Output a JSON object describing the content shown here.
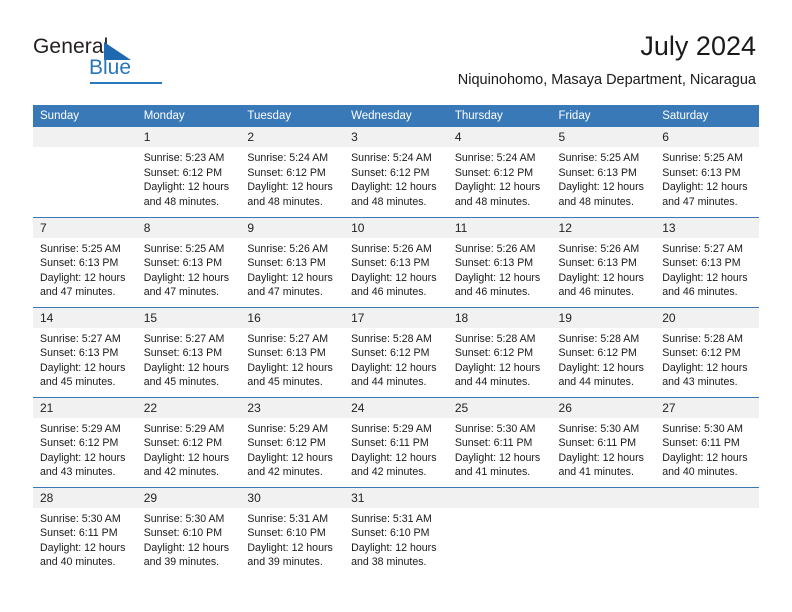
{
  "logo": {
    "primary_text": "General",
    "secondary_text": "Blue",
    "triangle_color": "#1f69b0",
    "blue_color": "#2777bc"
  },
  "header": {
    "title": "July 2024",
    "subtitle": "Niquinohomo, Masaya Department, Nicaragua"
  },
  "theme": {
    "header_blue": "#3a79b8",
    "daynum_gray": "#f1f1f1",
    "text_color": "#1a1a1a"
  },
  "calendar": {
    "weekday_headers": [
      "Sunday",
      "Monday",
      "Tuesday",
      "Wednesday",
      "Thursday",
      "Friday",
      "Saturday"
    ],
    "weeks": [
      [
        {
          "day": "",
          "sunrise": "",
          "sunset": "",
          "daylight_line1": "",
          "daylight_line2": ""
        },
        {
          "day": "1",
          "sunrise": "Sunrise: 5:23 AM",
          "sunset": "Sunset: 6:12 PM",
          "daylight_line1": "Daylight: 12 hours",
          "daylight_line2": "and 48 minutes."
        },
        {
          "day": "2",
          "sunrise": "Sunrise: 5:24 AM",
          "sunset": "Sunset: 6:12 PM",
          "daylight_line1": "Daylight: 12 hours",
          "daylight_line2": "and 48 minutes."
        },
        {
          "day": "3",
          "sunrise": "Sunrise: 5:24 AM",
          "sunset": "Sunset: 6:12 PM",
          "daylight_line1": "Daylight: 12 hours",
          "daylight_line2": "and 48 minutes."
        },
        {
          "day": "4",
          "sunrise": "Sunrise: 5:24 AM",
          "sunset": "Sunset: 6:12 PM",
          "daylight_line1": "Daylight: 12 hours",
          "daylight_line2": "and 48 minutes."
        },
        {
          "day": "5",
          "sunrise": "Sunrise: 5:25 AM",
          "sunset": "Sunset: 6:13 PM",
          "daylight_line1": "Daylight: 12 hours",
          "daylight_line2": "and 48 minutes."
        },
        {
          "day": "6",
          "sunrise": "Sunrise: 5:25 AM",
          "sunset": "Sunset: 6:13 PM",
          "daylight_line1": "Daylight: 12 hours",
          "daylight_line2": "and 47 minutes."
        }
      ],
      [
        {
          "day": "7",
          "sunrise": "Sunrise: 5:25 AM",
          "sunset": "Sunset: 6:13 PM",
          "daylight_line1": "Daylight: 12 hours",
          "daylight_line2": "and 47 minutes."
        },
        {
          "day": "8",
          "sunrise": "Sunrise: 5:25 AM",
          "sunset": "Sunset: 6:13 PM",
          "daylight_line1": "Daylight: 12 hours",
          "daylight_line2": "and 47 minutes."
        },
        {
          "day": "9",
          "sunrise": "Sunrise: 5:26 AM",
          "sunset": "Sunset: 6:13 PM",
          "daylight_line1": "Daylight: 12 hours",
          "daylight_line2": "and 47 minutes."
        },
        {
          "day": "10",
          "sunrise": "Sunrise: 5:26 AM",
          "sunset": "Sunset: 6:13 PM",
          "daylight_line1": "Daylight: 12 hours",
          "daylight_line2": "and 46 minutes."
        },
        {
          "day": "11",
          "sunrise": "Sunrise: 5:26 AM",
          "sunset": "Sunset: 6:13 PM",
          "daylight_line1": "Daylight: 12 hours",
          "daylight_line2": "and 46 minutes."
        },
        {
          "day": "12",
          "sunrise": "Sunrise: 5:26 AM",
          "sunset": "Sunset: 6:13 PM",
          "daylight_line1": "Daylight: 12 hours",
          "daylight_line2": "and 46 minutes."
        },
        {
          "day": "13",
          "sunrise": "Sunrise: 5:27 AM",
          "sunset": "Sunset: 6:13 PM",
          "daylight_line1": "Daylight: 12 hours",
          "daylight_line2": "and 46 minutes."
        }
      ],
      [
        {
          "day": "14",
          "sunrise": "Sunrise: 5:27 AM",
          "sunset": "Sunset: 6:13 PM",
          "daylight_line1": "Daylight: 12 hours",
          "daylight_line2": "and 45 minutes."
        },
        {
          "day": "15",
          "sunrise": "Sunrise: 5:27 AM",
          "sunset": "Sunset: 6:13 PM",
          "daylight_line1": "Daylight: 12 hours",
          "daylight_line2": "and 45 minutes."
        },
        {
          "day": "16",
          "sunrise": "Sunrise: 5:27 AM",
          "sunset": "Sunset: 6:13 PM",
          "daylight_line1": "Daylight: 12 hours",
          "daylight_line2": "and 45 minutes."
        },
        {
          "day": "17",
          "sunrise": "Sunrise: 5:28 AM",
          "sunset": "Sunset: 6:12 PM",
          "daylight_line1": "Daylight: 12 hours",
          "daylight_line2": "and 44 minutes."
        },
        {
          "day": "18",
          "sunrise": "Sunrise: 5:28 AM",
          "sunset": "Sunset: 6:12 PM",
          "daylight_line1": "Daylight: 12 hours",
          "daylight_line2": "and 44 minutes."
        },
        {
          "day": "19",
          "sunrise": "Sunrise: 5:28 AM",
          "sunset": "Sunset: 6:12 PM",
          "daylight_line1": "Daylight: 12 hours",
          "daylight_line2": "and 44 minutes."
        },
        {
          "day": "20",
          "sunrise": "Sunrise: 5:28 AM",
          "sunset": "Sunset: 6:12 PM",
          "daylight_line1": "Daylight: 12 hours",
          "daylight_line2": "and 43 minutes."
        }
      ],
      [
        {
          "day": "21",
          "sunrise": "Sunrise: 5:29 AM",
          "sunset": "Sunset: 6:12 PM",
          "daylight_line1": "Daylight: 12 hours",
          "daylight_line2": "and 43 minutes."
        },
        {
          "day": "22",
          "sunrise": "Sunrise: 5:29 AM",
          "sunset": "Sunset: 6:12 PM",
          "daylight_line1": "Daylight: 12 hours",
          "daylight_line2": "and 42 minutes."
        },
        {
          "day": "23",
          "sunrise": "Sunrise: 5:29 AM",
          "sunset": "Sunset: 6:12 PM",
          "daylight_line1": "Daylight: 12 hours",
          "daylight_line2": "and 42 minutes."
        },
        {
          "day": "24",
          "sunrise": "Sunrise: 5:29 AM",
          "sunset": "Sunset: 6:11 PM",
          "daylight_line1": "Daylight: 12 hours",
          "daylight_line2": "and 42 minutes."
        },
        {
          "day": "25",
          "sunrise": "Sunrise: 5:30 AM",
          "sunset": "Sunset: 6:11 PM",
          "daylight_line1": "Daylight: 12 hours",
          "daylight_line2": "and 41 minutes."
        },
        {
          "day": "26",
          "sunrise": "Sunrise: 5:30 AM",
          "sunset": "Sunset: 6:11 PM",
          "daylight_line1": "Daylight: 12 hours",
          "daylight_line2": "and 41 minutes."
        },
        {
          "day": "27",
          "sunrise": "Sunrise: 5:30 AM",
          "sunset": "Sunset: 6:11 PM",
          "daylight_line1": "Daylight: 12 hours",
          "daylight_line2": "and 40 minutes."
        }
      ],
      [
        {
          "day": "28",
          "sunrise": "Sunrise: 5:30 AM",
          "sunset": "Sunset: 6:11 PM",
          "daylight_line1": "Daylight: 12 hours",
          "daylight_line2": "and 40 minutes."
        },
        {
          "day": "29",
          "sunrise": "Sunrise: 5:30 AM",
          "sunset": "Sunset: 6:10 PM",
          "daylight_line1": "Daylight: 12 hours",
          "daylight_line2": "and 39 minutes."
        },
        {
          "day": "30",
          "sunrise": "Sunrise: 5:31 AM",
          "sunset": "Sunset: 6:10 PM",
          "daylight_line1": "Daylight: 12 hours",
          "daylight_line2": "and 39 minutes."
        },
        {
          "day": "31",
          "sunrise": "Sunrise: 5:31 AM",
          "sunset": "Sunset: 6:10 PM",
          "daylight_line1": "Daylight: 12 hours",
          "daylight_line2": "and 38 minutes."
        },
        {
          "day": "",
          "sunrise": "",
          "sunset": "",
          "daylight_line1": "",
          "daylight_line2": ""
        },
        {
          "day": "",
          "sunrise": "",
          "sunset": "",
          "daylight_line1": "",
          "daylight_line2": ""
        },
        {
          "day": "",
          "sunrise": "",
          "sunset": "",
          "daylight_line1": "",
          "daylight_line2": ""
        }
      ]
    ]
  }
}
